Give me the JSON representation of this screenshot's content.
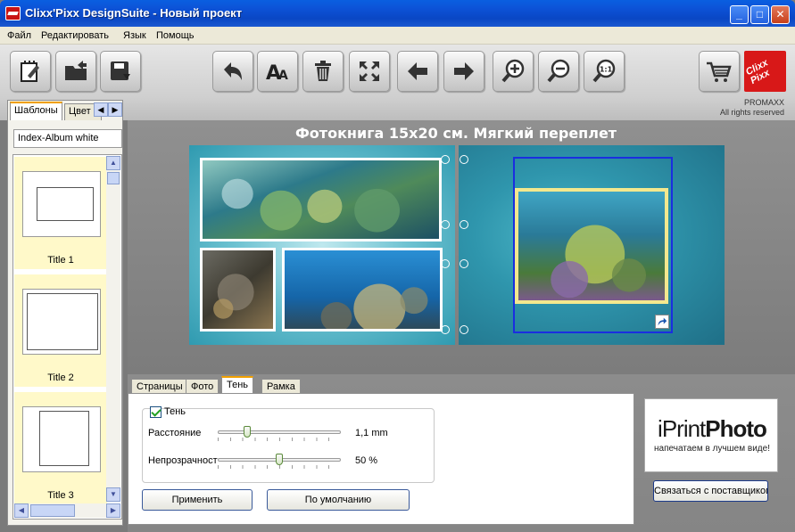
{
  "window": {
    "title": "Clixx'Pixx DesignSuite - Новый проект",
    "minimize": "_",
    "maximize": "□",
    "close": "✕"
  },
  "menu": [
    "Файл",
    "Редактировать",
    "Язык",
    "Помощь"
  ],
  "toolbar": {
    "buttons": [
      {
        "icon": "new-project-icon"
      },
      {
        "icon": "open-folder-icon"
      },
      {
        "icon": "save-disk-icon"
      },
      {
        "icon": "undo-icon"
      },
      {
        "icon": "text-font-icon"
      },
      {
        "icon": "trash-icon"
      },
      {
        "icon": "fit-screen-icon"
      },
      {
        "icon": "arrow-left-icon"
      },
      {
        "icon": "arrow-right-icon"
      },
      {
        "icon": "zoom-in-icon"
      },
      {
        "icon": "zoom-out-icon"
      },
      {
        "icon": "zoom-100-icon"
      },
      {
        "icon": "shopping-cart-icon"
      }
    ],
    "zoom_100_label": "1:1",
    "logo_text": "Clixx Pixx",
    "brand": "PROMAXX",
    "rights": "All rights reserved"
  },
  "left_panel": {
    "tabs": [
      "Шаблоны",
      "Цвет"
    ],
    "selected_template_set": "Index-Album white",
    "templates": [
      {
        "label": "Title 1"
      },
      {
        "label": "Title 2"
      },
      {
        "label": "Title 3"
      }
    ]
  },
  "workspace": {
    "book_title": "Фотокнига 15x20 см. Мягкий переплет"
  },
  "bottom_panel": {
    "tabs": [
      "Страницы",
      "Фото",
      "Тень",
      "Рамка"
    ],
    "active_tab": "Тень",
    "shadow_checkbox_label": "Тень",
    "shadow_enabled": true,
    "distance_label": "Расстояние",
    "distance_value": "1,1 mm",
    "distance_fraction": 0.22,
    "opacity_label": "Непрозрачност",
    "opacity_value": "50 %",
    "opacity_fraction": 0.5,
    "apply_button": "Применить",
    "default_button": "По умолчанию"
  },
  "ad": {
    "brand_light": "iPrint",
    "brand_bold": "Photo",
    "tagline": "напечатаем в лучшем виде!",
    "contact_button": "Связаться с поставщиком"
  },
  "colors": {
    "titlebar": "#0a5fe0",
    "tab_accent": "#f0a000",
    "selection_frame": "#1a2ee0",
    "photo_highlight": "#f3e88e",
    "logo_red": "#d81818"
  }
}
